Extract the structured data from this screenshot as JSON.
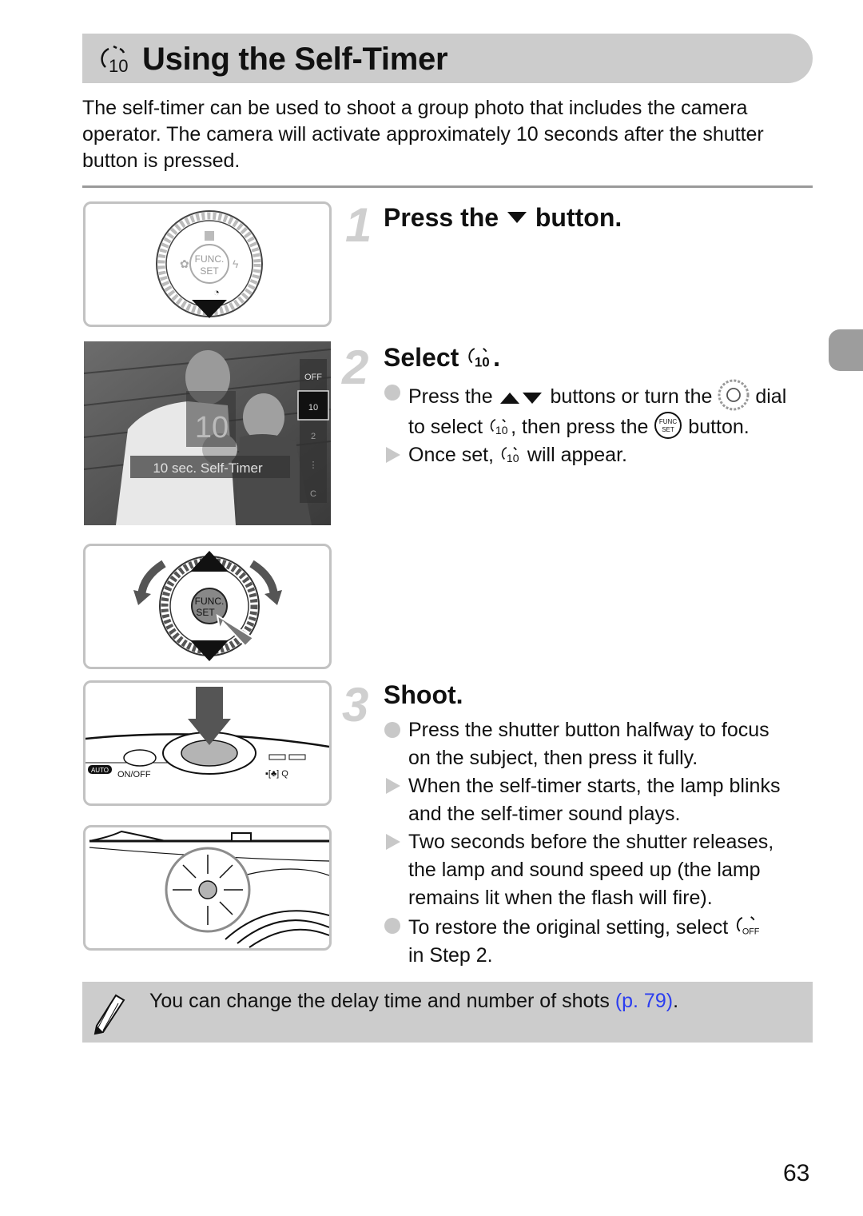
{
  "header": {
    "title": "Using the Self-Timer",
    "icon": "self-timer-10-icon"
  },
  "intro": "The self-timer can be used to shoot a group photo that includes the camera operator. The camera will activate approximately 10 seconds after the shutter button is pressed.",
  "steps": [
    {
      "number": "1",
      "title_before": "Press the",
      "title_icon": "down-triangle-icon",
      "title_after": "button."
    },
    {
      "number": "2",
      "title_before": "Select",
      "title_icon": "self-timer-10-icon",
      "title_after": ".",
      "bullets": [
        {
          "type": "dot",
          "parts": [
            "Press the",
            "buttons or turn the",
            "dial",
            "to select",
            ", then press the",
            "button."
          ]
        },
        {
          "type": "arrow",
          "parts": [
            "Once set,",
            "will appear."
          ]
        }
      ]
    },
    {
      "number": "3",
      "title": "Shoot.",
      "bullets": [
        {
          "type": "dot",
          "text_lines": [
            "Press the shutter button halfway to focus",
            "on the subject, then press it fully."
          ]
        },
        {
          "type": "arrow",
          "text_lines": [
            "When the self-timer starts, the lamp blinks",
            "and the self-timer sound plays."
          ]
        },
        {
          "type": "arrow",
          "text_lines": [
            "Two seconds before the shutter releases,",
            "the lamp and sound speed up (the lamp",
            "remains lit when the flash will fire)."
          ]
        },
        {
          "type": "dot",
          "text_lines": [
            "To restore the original setting, select",
            "in Step 2."
          ]
        }
      ]
    }
  ],
  "figures": {
    "control_dial": {
      "center_label_1": "FUNC.",
      "center_label_2": "SET"
    },
    "screen": {
      "overlay_label": "10 sec. Self-Timer",
      "big_icon_label": "10",
      "menu_items": [
        {
          "label": "OFF",
          "selected": false
        },
        {
          "label": "10",
          "selected": true
        },
        {
          "label": "2",
          "selected": false
        },
        {
          "label": "custom",
          "selected": false
        },
        {
          "label": "C",
          "selected": false
        }
      ]
    },
    "camera_top": {
      "mode_label": "AUTO",
      "power_label": "ON/OFF"
    }
  },
  "note": {
    "text": "You can change the delay time and number of shots",
    "link": "(p. 79)",
    "suffix": "."
  },
  "page_number": "63",
  "colors": {
    "link": "#2b3df0",
    "title_bar": "#cccccc",
    "note_bg": "#cccccc"
  }
}
